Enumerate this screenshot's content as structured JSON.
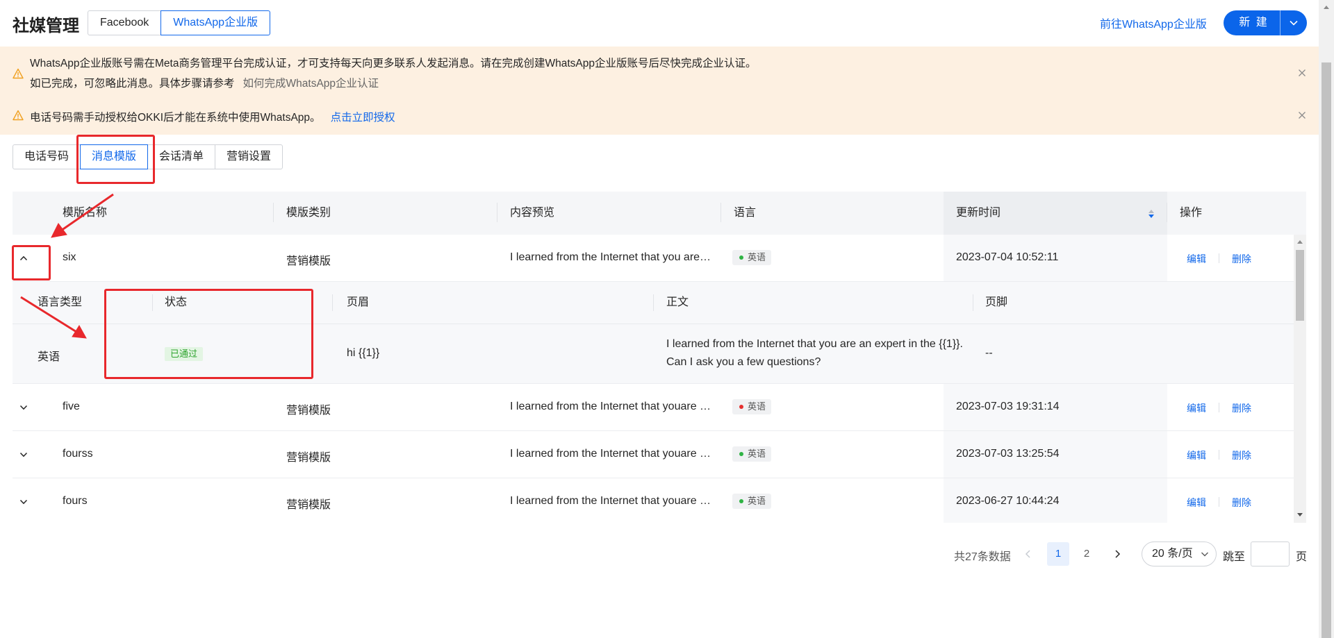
{
  "header": {
    "title": "社媒管理",
    "platform_tabs": [
      {
        "label": "Facebook",
        "active": false
      },
      {
        "label": "WhatsApp企业版",
        "active": true
      }
    ],
    "goto_link": "前往WhatsApp企业版",
    "new_button": "新 建"
  },
  "alerts": {
    "alert1": {
      "line1": "WhatsApp企业版账号需在Meta商务管理平台完成认证，才可支持每天向更多联系人发起消息。请在完成创建WhatsApp企业版账号后尽快完成企业认证。",
      "line2": "如已完成，可忽略此消息。具体步骤请参考",
      "link": "如何完成WhatsApp企业认证"
    },
    "alert2": {
      "text": "电话号码需手动授权给OKKI后才能在系统中使用WhatsApp。",
      "link": "点击立即授权"
    }
  },
  "sub_tabs": [
    {
      "label": "电话号码",
      "active": false
    },
    {
      "label": "消息模版",
      "active": true
    },
    {
      "label": "会话清单",
      "active": false
    },
    {
      "label": "营销设置",
      "active": false
    }
  ],
  "table": {
    "columns": [
      "模版名称",
      "模版类别",
      "内容预览",
      "语言",
      "更新时间",
      "操作"
    ],
    "rows": [
      {
        "name": "six",
        "category": "营销模版",
        "preview": "I learned from the Internet that you are…",
        "language": "英语",
        "status_color": "#2fb344",
        "updated": "2023-07-04 10:52:11",
        "edit": "编辑",
        "delete": "删除",
        "expanded": true
      },
      {
        "name": "five",
        "category": "营销模版",
        "preview": "I learned from the Internet that youare …",
        "language": "英语",
        "status_color": "#e5302f",
        "updated": "2023-07-03 19:31:14",
        "edit": "编辑",
        "delete": "删除",
        "expanded": false
      },
      {
        "name": "fourss",
        "category": "营销模版",
        "preview": "I learned from the Internet that youare …",
        "language": "英语",
        "status_color": "#2fb344",
        "updated": "2023-07-03 13:25:54",
        "edit": "编辑",
        "delete": "删除",
        "expanded": false
      },
      {
        "name": "fours",
        "category": "营销模版",
        "preview": "I learned from the Internet that youare …",
        "language": "英语",
        "status_color": "#2fb344",
        "updated": "2023-06-27 10:44:24",
        "edit": "编辑",
        "delete": "删除",
        "expanded": false
      }
    ],
    "detail": {
      "columns": [
        "语言类型",
        "状态",
        "页眉",
        "正文",
        "页脚"
      ],
      "language": "英语",
      "status": "已通过",
      "header": "hi {{1}}",
      "body_line1": "I learned from the Internet that you are an expert in the {{1}}.",
      "body_line2": "Can I ask you a few questions?",
      "footer": "--"
    }
  },
  "pagination": {
    "total": "共27条数据",
    "pages": [
      "1",
      "2"
    ],
    "current": "1",
    "page_size": "20 条/页",
    "jump_label": "跳至",
    "jump_unit": "页"
  },
  "icons": {
    "warning": "warning-triangle-icon",
    "close": "close-icon",
    "expand": "chevron-down-icon",
    "collapse": "chevron-up-icon",
    "sort": "sort-icon"
  },
  "colors": {
    "primary": "#1268ea",
    "alert_bg": "#fdf0e1",
    "annotation": "#e8282c"
  }
}
